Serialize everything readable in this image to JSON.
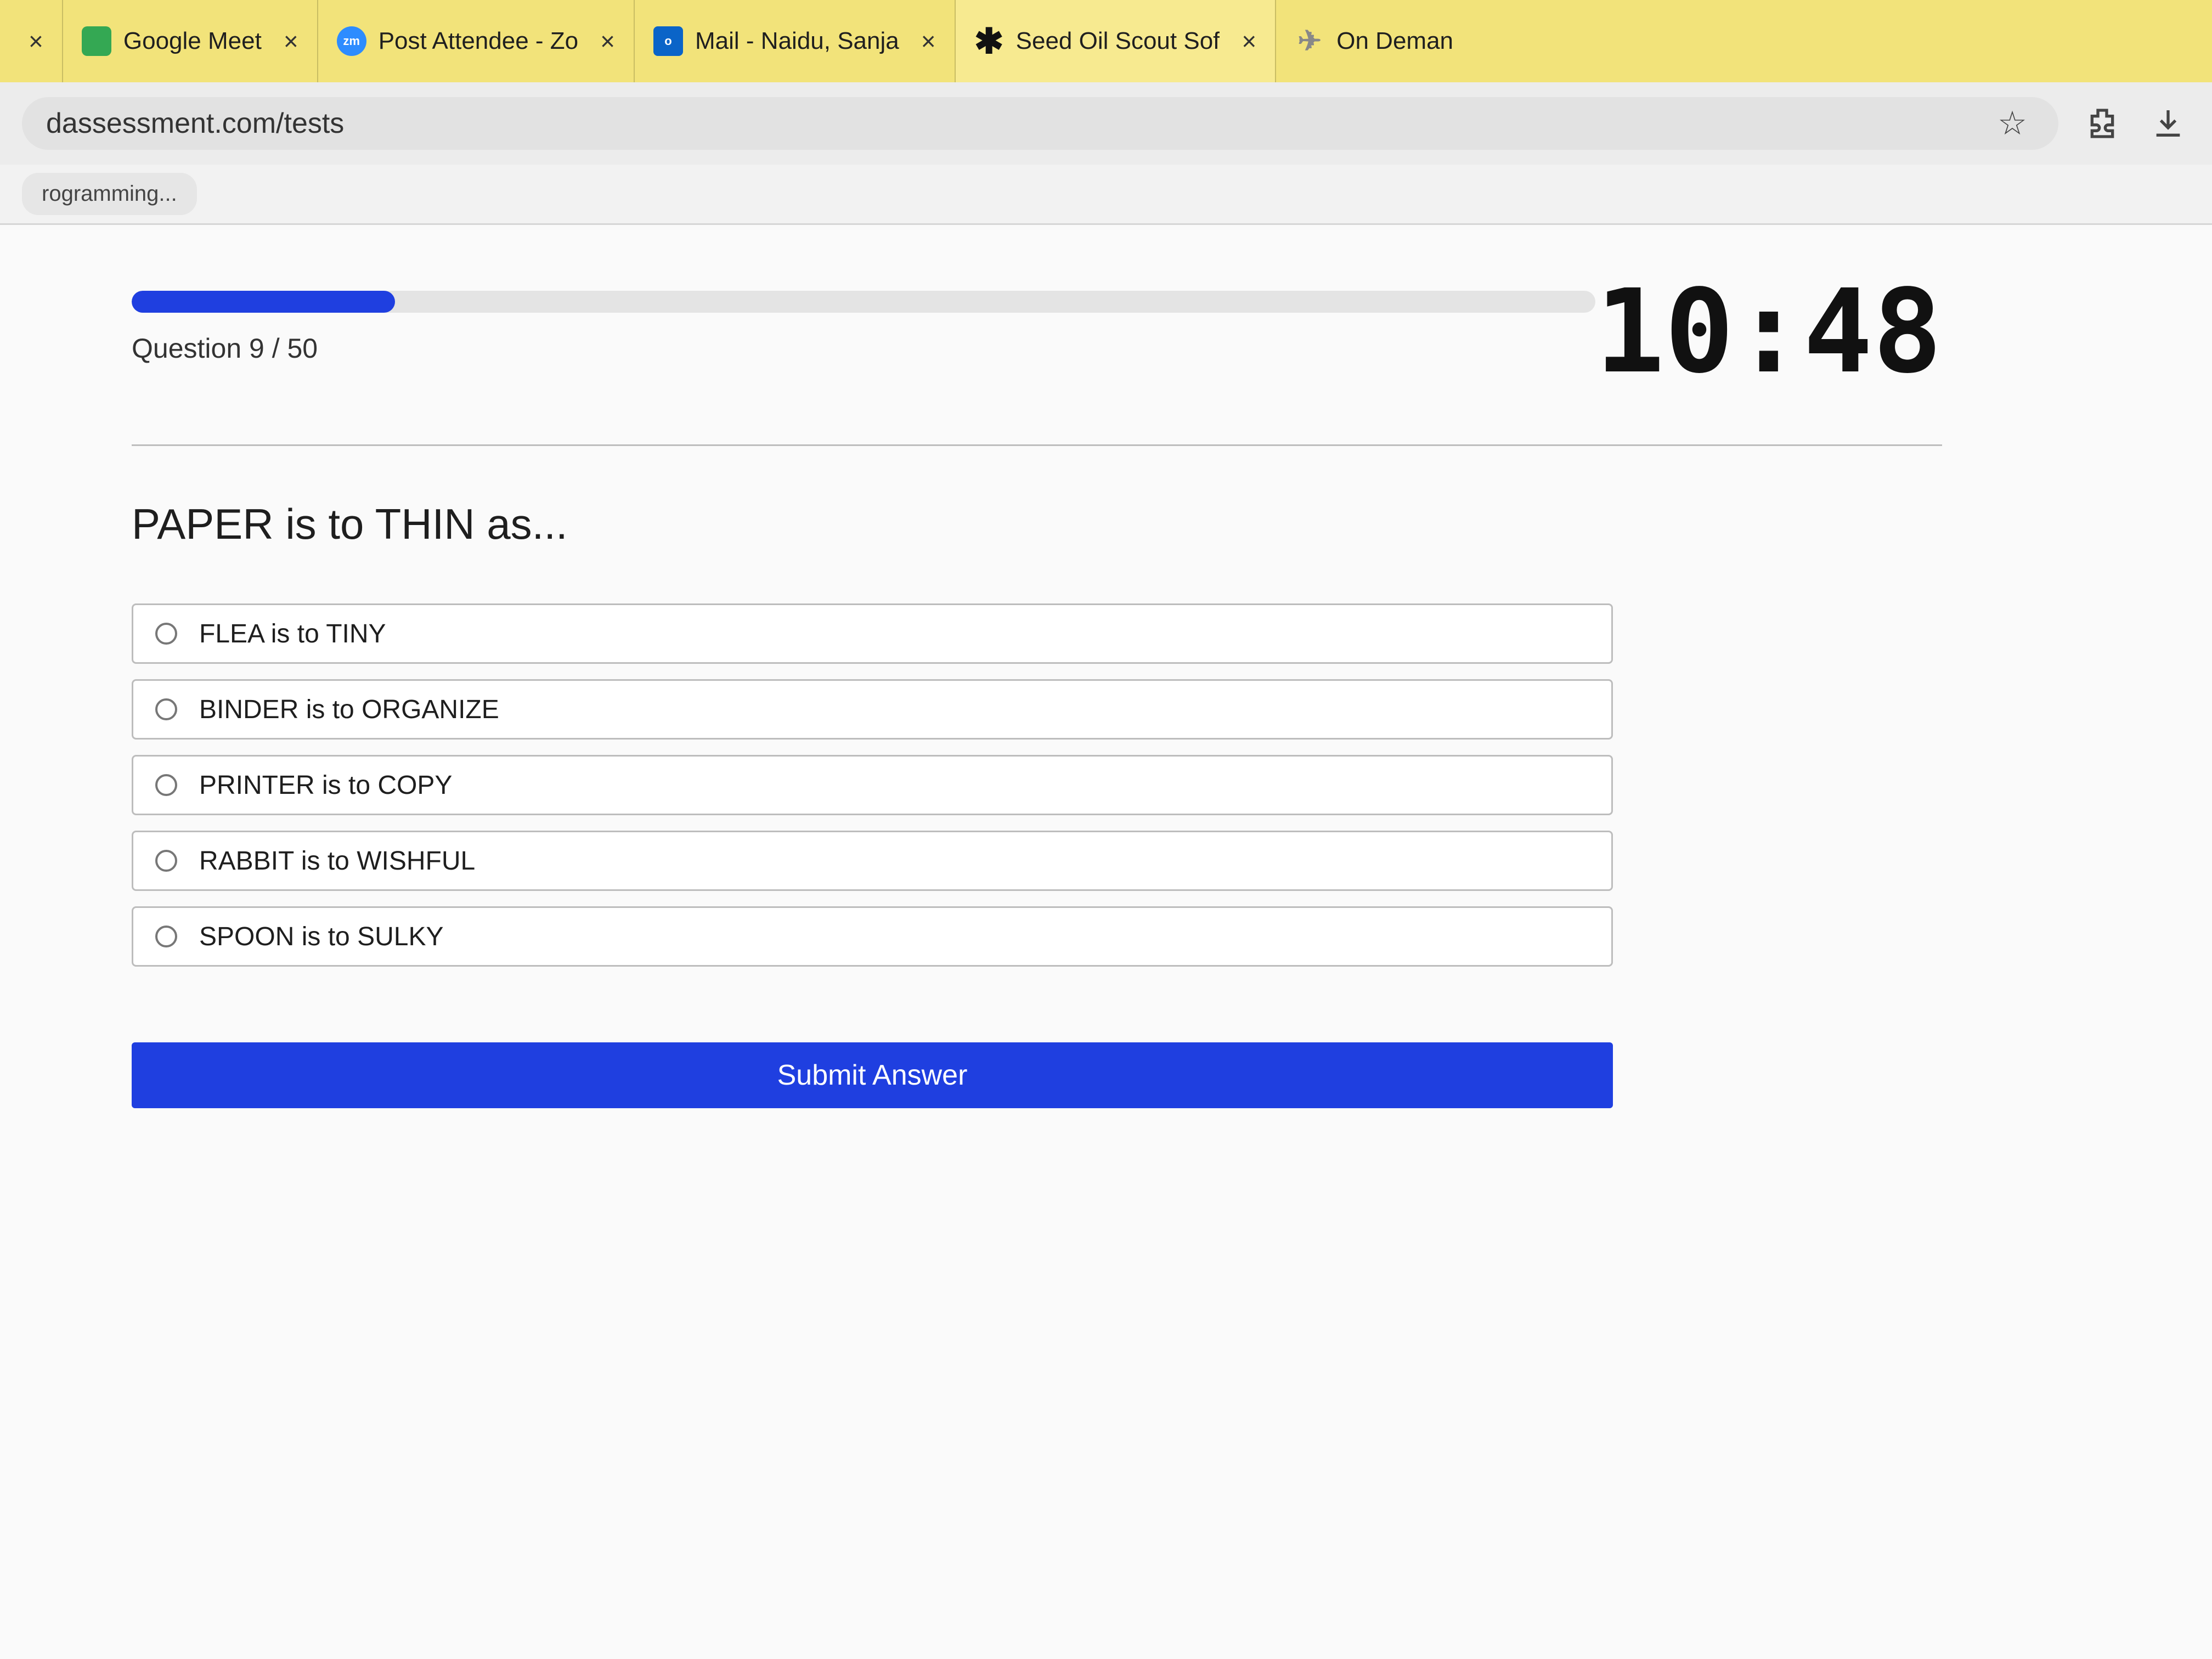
{
  "browser": {
    "tabs": [
      {
        "title": "",
        "favicon": "blank",
        "close": "×",
        "active": false
      },
      {
        "title": "Google Meet",
        "favicon": "google-meet-icon",
        "close": "×",
        "active": false
      },
      {
        "title": "Post Attendee - Zo",
        "favicon": "zoom-icon",
        "favicon_text": "zm",
        "close": "×",
        "active": false
      },
      {
        "title": "Mail - Naidu, Sanja",
        "favicon": "outlook-icon",
        "favicon_text": "o",
        "close": "×",
        "active": false
      },
      {
        "title": "Seed Oil Scout Sof",
        "favicon": "asterisk-icon",
        "favicon_text": "✱",
        "close": "×",
        "active": true
      },
      {
        "title": "On Deman",
        "favicon": "ondemand-icon",
        "favicon_text": "✈",
        "close": "",
        "active": false
      }
    ],
    "address": "dassessment.com/tests",
    "bookmark": "rogramming..."
  },
  "test": {
    "timer": "10:48",
    "progress_label": "Question 9 / 50",
    "progress_fraction": 0.18,
    "question": "PAPER is to THIN as...",
    "options": [
      "FLEA is to TINY",
      "BINDER is to ORGANIZE",
      "PRINTER is to COPY",
      "RABBIT is to WISHFUL",
      "SPOON is to SULKY"
    ],
    "submit_label": "Submit Answer"
  },
  "colors": {
    "accent": "#1f3fe0",
    "tabstrip": "#f2e37a"
  }
}
